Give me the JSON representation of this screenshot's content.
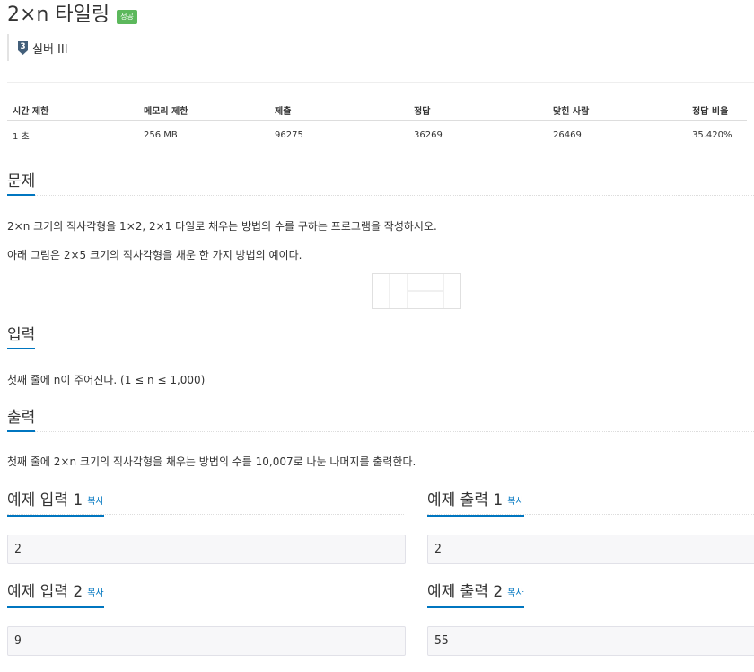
{
  "problem": {
    "title": "2×n 타일링",
    "result_badge": "성공",
    "tier": {
      "number": "3",
      "label": "실버 III",
      "color": "#435f7a"
    },
    "badge_color": "#5cb85c",
    "accent_color": "#0076c0"
  },
  "stats": {
    "headers": [
      "시간 제한",
      "메모리 제한",
      "제출",
      "정답",
      "맞힌 사람",
      "정답 비율"
    ],
    "values": [
      "1 초",
      "256 MB",
      "96275",
      "36269",
      "26469",
      "35.420%"
    ]
  },
  "sections": {
    "description": {
      "title": "문제",
      "paragraphs": [
        "2×n 크기의 직사각형을 1×2, 2×1 타일로 채우는 방법의 수를 구하는 프로그램을 작성하시오.",
        "아래 그림은 2×5 크기의 직사각형을 채운 한 가지 방법의 예이다."
      ]
    },
    "input": {
      "title": "입력",
      "text": "첫째 줄에 n이 주어진다. (1 ≤ n ≤ 1,000)"
    },
    "output": {
      "title": "출력",
      "text": "첫째 줄에 2×n 크기의 직사각형을 채우는 방법의 수를 10,007로 나눈 나머지를 출력한다."
    }
  },
  "samples": {
    "copy_label": "복사",
    "items": [
      {
        "input_title": "예제 입력 1",
        "output_title": "예제 출력 1",
        "input": "2",
        "output": "2"
      },
      {
        "input_title": "예제 입력 2",
        "output_title": "예제 출력 2",
        "input": "9",
        "output": "55"
      }
    ]
  }
}
